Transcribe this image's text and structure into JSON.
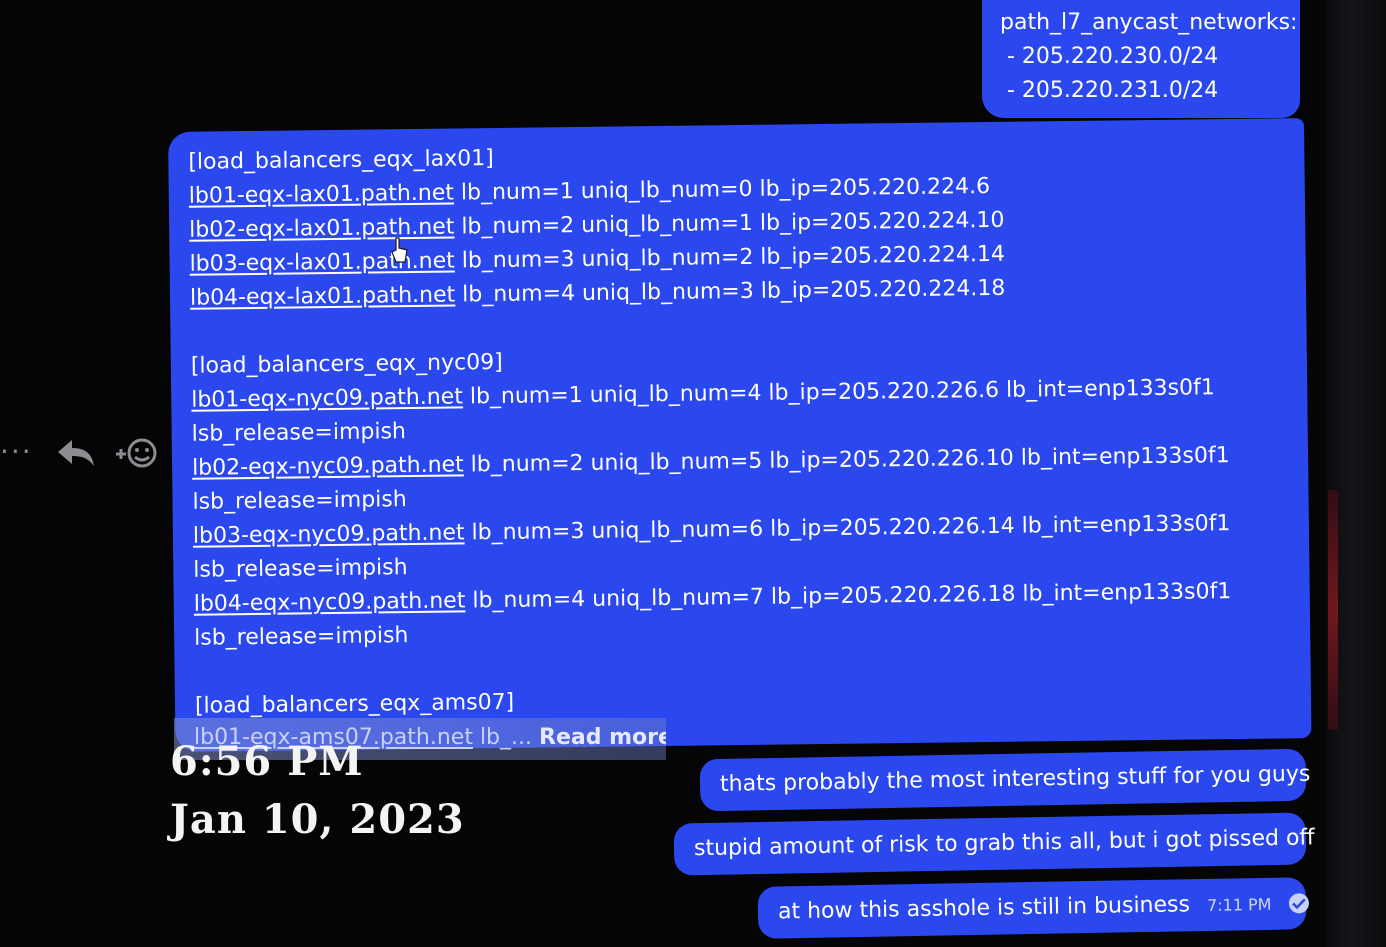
{
  "top_message": {
    "lines": [
      "path_l7_anycast_networks:",
      " - 205.220.230.0/24",
      " - 205.220.231.0/24"
    ]
  },
  "main_message": {
    "lines": [
      {
        "text": "[load_balancers_eqx_lax01]"
      },
      {
        "link": "lb01-eqx-lax01.path.net",
        "text": " lb_num=1 uniq_lb_num=0 lb_ip=205.220.224.6"
      },
      {
        "link": "lb02-eqx-lax01.path.net",
        "text": " lb_num=2 uniq_lb_num=1 lb_ip=205.220.224.10"
      },
      {
        "link": "lb03-eqx-lax01.path.net",
        "text": " lb_num=3 uniq_lb_num=2 lb_ip=205.220.224.14"
      },
      {
        "link": "lb04-eqx-lax01.path.net",
        "text": " lb_num=4 uniq_lb_num=3 lb_ip=205.220.224.18"
      },
      {
        "text": ""
      },
      {
        "text": "[load_balancers_eqx_nyc09]"
      },
      {
        "link": "lb01-eqx-nyc09.path.net",
        "text": " lb_num=1 uniq_lb_num=4 lb_ip=205.220.226.6 lb_int=enp133s0f1"
      },
      {
        "text": "lsb_release=impish"
      },
      {
        "link": "lb02-eqx-nyc09.path.net",
        "text": " lb_num=2 uniq_lb_num=5 lb_ip=205.220.226.10 lb_int=enp133s0f1"
      },
      {
        "text": "lsb_release=impish"
      },
      {
        "link": "lb03-eqx-nyc09.path.net",
        "text": " lb_num=3 uniq_lb_num=6 lb_ip=205.220.226.14 lb_int=enp133s0f1"
      },
      {
        "text": "lsb_release=impish"
      },
      {
        "link": "lb04-eqx-nyc09.path.net",
        "text": " lb_num=4 uniq_lb_num=7 lb_ip=205.220.226.18 lb_int=enp133s0f1"
      },
      {
        "text": "lsb_release=impish"
      },
      {
        "text": ""
      },
      {
        "text": "[load_balancers_eqx_ams07]"
      }
    ],
    "truncated_link": "lb01-eqx-ams07.path.net",
    "truncated_text": " lb_...",
    "read_more_label": "Read more"
  },
  "follow_messages": [
    {
      "text": "thats probably the most interesting stuff for you guys"
    },
    {
      "text": "stupid amount of risk to grab this all, but i got pissed off"
    },
    {
      "text": "at how this asshole is still in business",
      "time": "7:11 PM"
    }
  ],
  "timestamp_overlay": {
    "time": "6:56 PM",
    "date": "Jan 10, 2023"
  },
  "actions": {
    "icons": [
      "more-icon",
      "reply-icon",
      "add-reaction-icon"
    ]
  },
  "colors": {
    "bubble": "#2b48ee",
    "background": "#050506",
    "text": "#ffffff"
  }
}
